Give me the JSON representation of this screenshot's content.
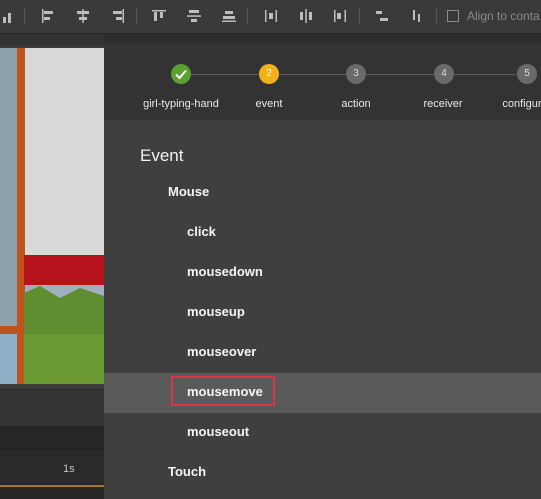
{
  "toolbar": {
    "icons": [
      "align-left-icon",
      "align-center-h-icon",
      "align-right-icon",
      "align-top-icon",
      "align-center-v-icon",
      "align-bottom-icon",
      "distribute-h-icon",
      "distribute-center-h-icon",
      "distribute-right-icon",
      "distribute-v-icon",
      "distribute-center-v-icon"
    ],
    "align_label": "Align to conta"
  },
  "timeline": {
    "time_label": "1s"
  },
  "wizard": {
    "steps": [
      {
        "number": "",
        "label": "girl-typing-hand",
        "state": "done"
      },
      {
        "number": "2",
        "label": "event",
        "state": "active"
      },
      {
        "number": "3",
        "label": "action",
        "state": "pending"
      },
      {
        "number": "4",
        "label": "receiver",
        "state": "pending"
      },
      {
        "number": "5",
        "label": "configura",
        "state": "pending"
      }
    ],
    "heading": "Event",
    "group_mouse": "Mouse",
    "mouse_events": [
      "click",
      "mousedown",
      "mouseup",
      "mouseover",
      "mousemove",
      "mouseout"
    ],
    "selected_event": "mousemove",
    "group_touch": "Touch"
  },
  "colors": {
    "done": "#5aa130",
    "active": "#f1b01c",
    "highlight_box": "#d9364a"
  }
}
